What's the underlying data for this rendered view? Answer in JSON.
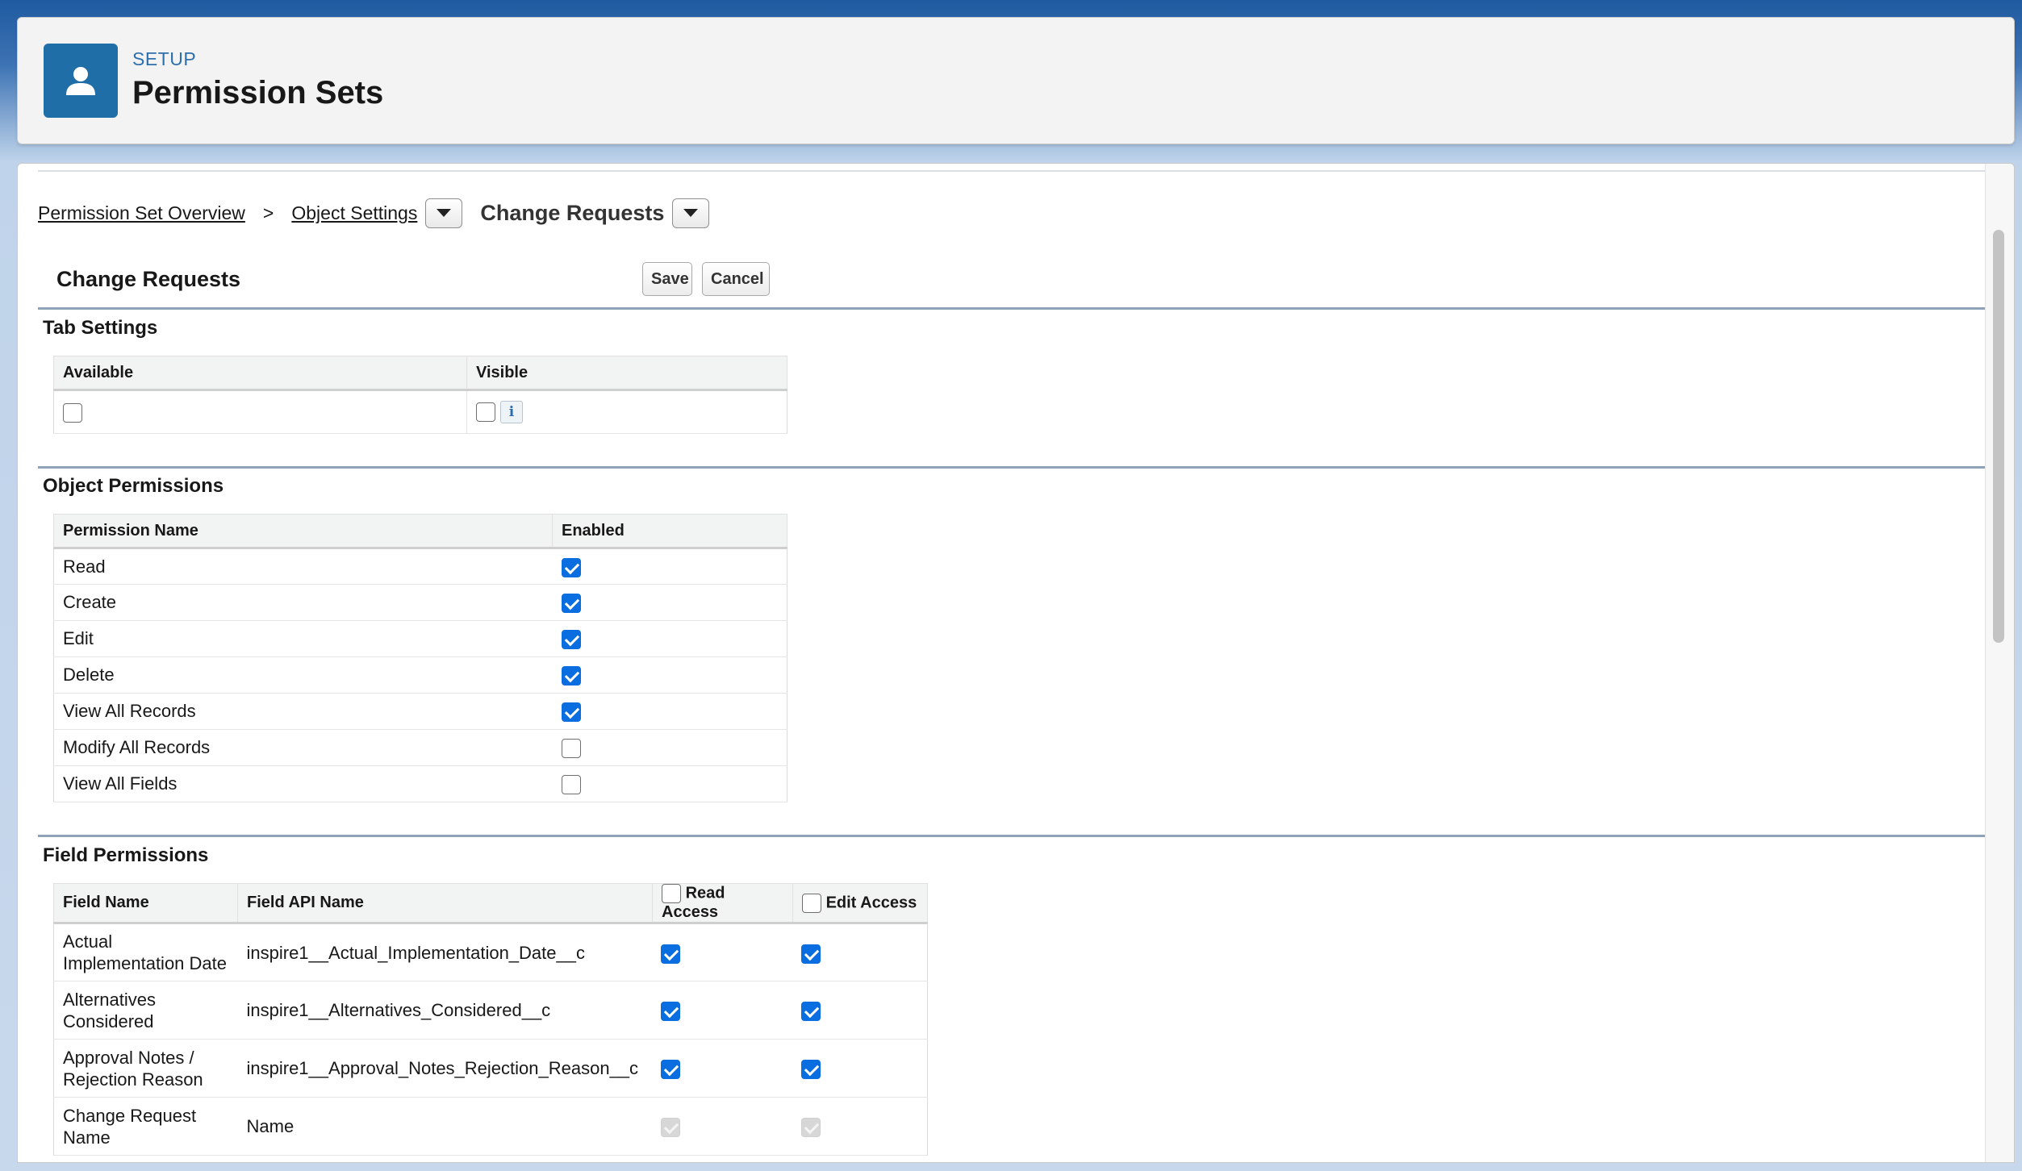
{
  "header": {
    "eyebrow": "SETUP",
    "title": "Permission Sets",
    "icon": "user-icon"
  },
  "breadcrumb": {
    "overview": "Permission Set Overview",
    "separator": ">",
    "object_settings": "Object Settings",
    "current": "Change Requests"
  },
  "page": {
    "title": "Change Requests",
    "save_label": "Save",
    "cancel_label": "Cancel"
  },
  "tab_settings": {
    "title": "Tab Settings",
    "columns": [
      "Available",
      "Visible"
    ],
    "available_checked": false,
    "visible_checked": false,
    "info_glyph": "i"
  },
  "object_permissions": {
    "title": "Object Permissions",
    "columns": [
      "Permission Name",
      "Enabled"
    ],
    "rows": [
      {
        "name": "Read",
        "enabled": true
      },
      {
        "name": "Create",
        "enabled": true
      },
      {
        "name": "Edit",
        "enabled": true
      },
      {
        "name": "Delete",
        "enabled": true
      },
      {
        "name": "View All Records",
        "enabled": true
      },
      {
        "name": "Modify All Records",
        "enabled": false
      },
      {
        "name": "View All Fields",
        "enabled": false
      }
    ]
  },
  "field_permissions": {
    "title": "Field Permissions",
    "columns": [
      "Field Name",
      "Field API Name",
      "Read Access",
      "Edit Access"
    ],
    "rows": [
      {
        "name_line1": "Actual",
        "name_line2": "Implementation Date",
        "api": "inspire1__Actual_Implementation_Date__c",
        "read": "checked",
        "edit": "checked"
      },
      {
        "name_line1": "Alternatives",
        "name_line2": "Considered",
        "api": "inspire1__Alternatives_Considered__c",
        "read": "checked",
        "edit": "checked"
      },
      {
        "name_line1": "Approval Notes /",
        "name_line2": "Rejection Reason",
        "api": "inspire1__Approval_Notes_Rejection_Reason__c",
        "read": "checked",
        "edit": "checked"
      },
      {
        "name_line1": "Change Request",
        "name_line2": "Name",
        "api": "Name",
        "read": "disabled",
        "edit": "disabled"
      }
    ]
  }
}
